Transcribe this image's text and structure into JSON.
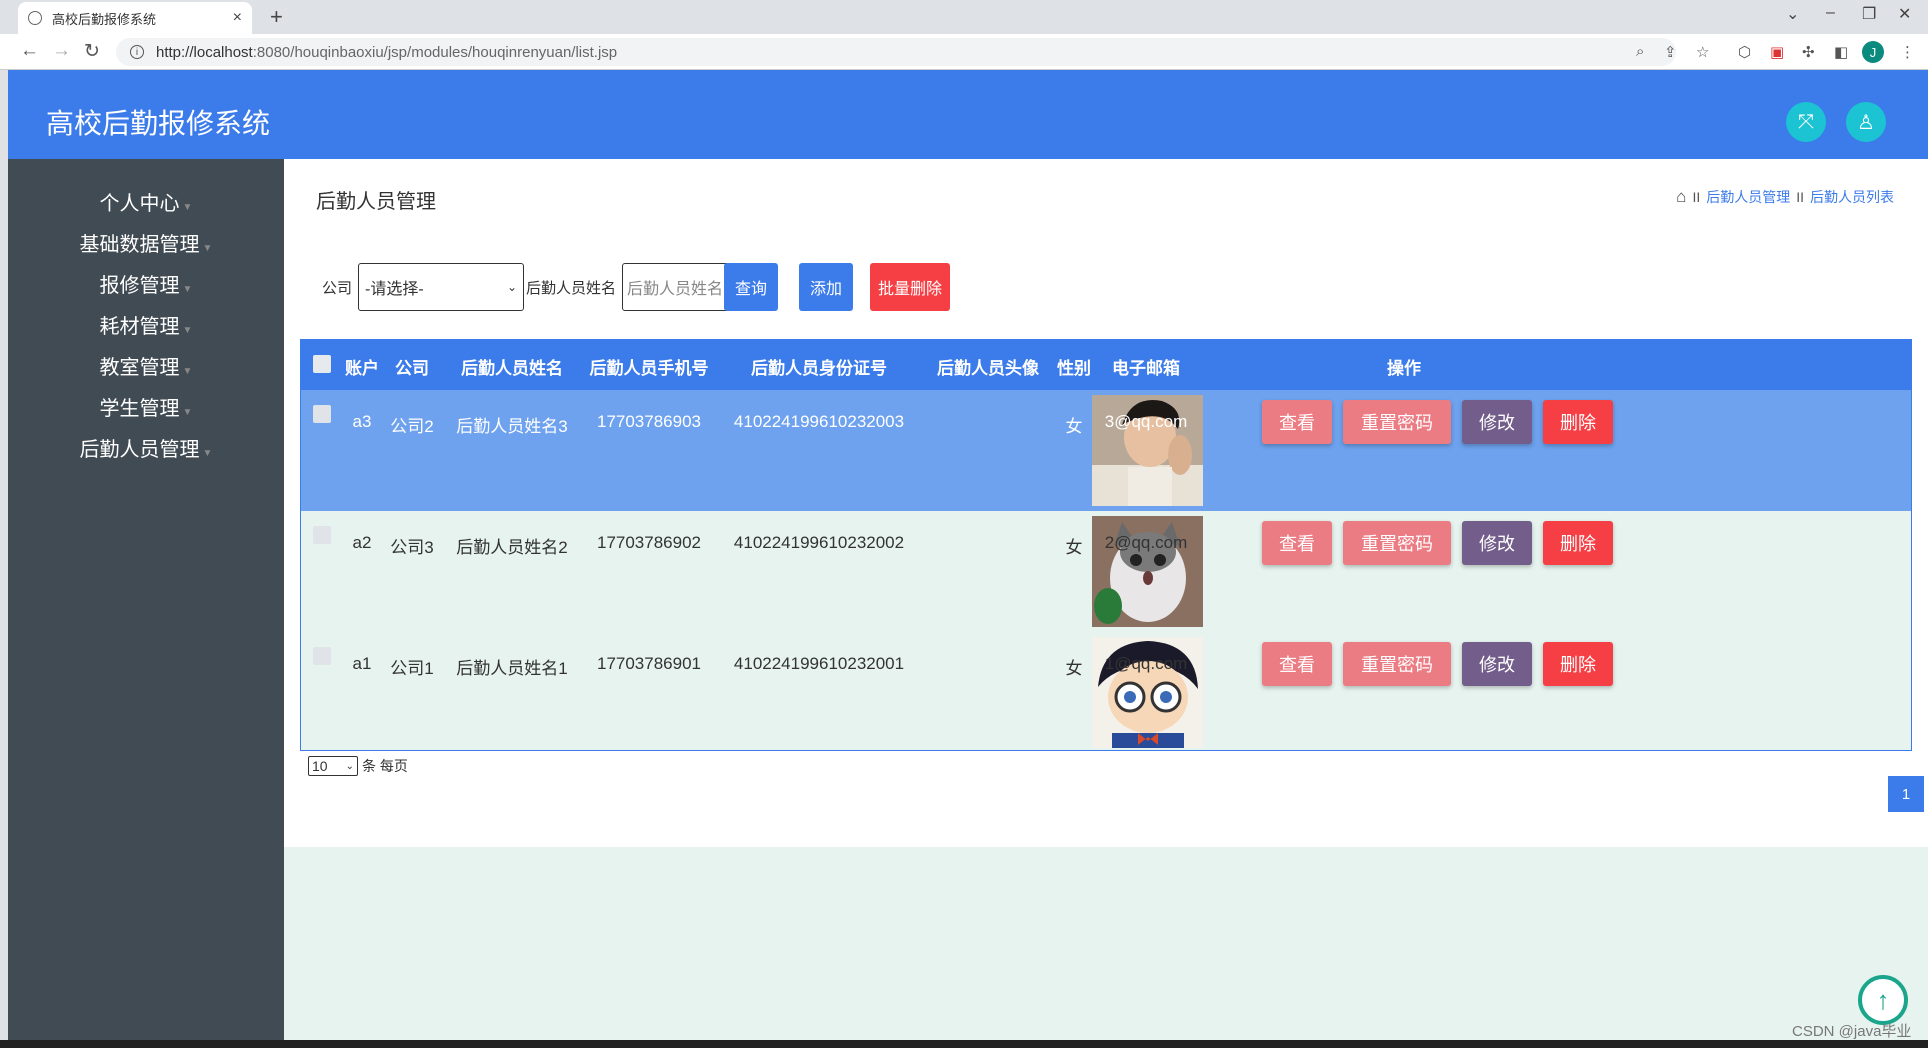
{
  "browser": {
    "tab_title": "高校后勤报修系统",
    "tab_close": "×",
    "new_tab": "+",
    "url_host": "http://localhost",
    "url_rest": ":8080/houqinbaoxiu/jsp/modules/houqinrenyuan/list.jsp",
    "profile_initial": "J"
  },
  "header": {
    "title": "高校后勤报修系统"
  },
  "sidebar": {
    "items": [
      {
        "label": "个人中心"
      },
      {
        "label": "基础数据管理"
      },
      {
        "label": "报修管理"
      },
      {
        "label": "耗材管理"
      },
      {
        "label": "教室管理"
      },
      {
        "label": "学生管理"
      },
      {
        "label": "后勤人员管理"
      }
    ]
  },
  "page": {
    "heading": "后勤人员管理",
    "breadcrumb": [
      "后勤人员管理",
      "后勤人员列表"
    ],
    "breadcrumb_sep": "II"
  },
  "search": {
    "company_label": "公司",
    "company_value": "-请选择-",
    "name_label": "后勤人员姓名",
    "name_placeholder": "后勤人员姓名",
    "query_label": "查询",
    "add_label": "添加",
    "batch_delete_label": "批量删除"
  },
  "colors": {
    "primary": "#3b7bea",
    "sidebar": "#414b53",
    "view_btn": "#ec7c84",
    "reset_btn": "#ec7c84",
    "edit_btn": "#735d8a",
    "delete_btn": "#f53f44",
    "batch_delete_btn": "#f53f44"
  },
  "table": {
    "columns": [
      "账户",
      "公司",
      "后勤人员姓名",
      "后勤人员手机号",
      "后勤人员身份证号",
      "后勤人员头像",
      "性别",
      "电子邮箱",
      "操作"
    ],
    "rows": [
      {
        "account": "a3",
        "company": "公司2",
        "name": "后勤人员姓名3",
        "phone": "17703786903",
        "idcard": "410224199610232003",
        "avatar": "young-man-photo",
        "gender": "女",
        "email": "3@qq.com"
      },
      {
        "account": "a2",
        "company": "公司3",
        "name": "后勤人员姓名2",
        "phone": "17703786902",
        "idcard": "410224199610232002",
        "avatar": "cat-photo",
        "gender": "女",
        "email": "2@qq.com"
      },
      {
        "account": "a1",
        "company": "公司1",
        "name": "后勤人员姓名1",
        "phone": "17703786901",
        "idcard": "410224199610232001",
        "avatar": "cartoon-boy-glasses",
        "gender": "女",
        "email": "1@qq.com"
      }
    ],
    "actions": {
      "view": "查看",
      "reset": "重置密码",
      "edit": "修改",
      "delete": "删除"
    }
  },
  "pager": {
    "page_size": "10",
    "suffix": "条 每页",
    "current_page": "1"
  },
  "watermark": "CSDN @java毕业"
}
